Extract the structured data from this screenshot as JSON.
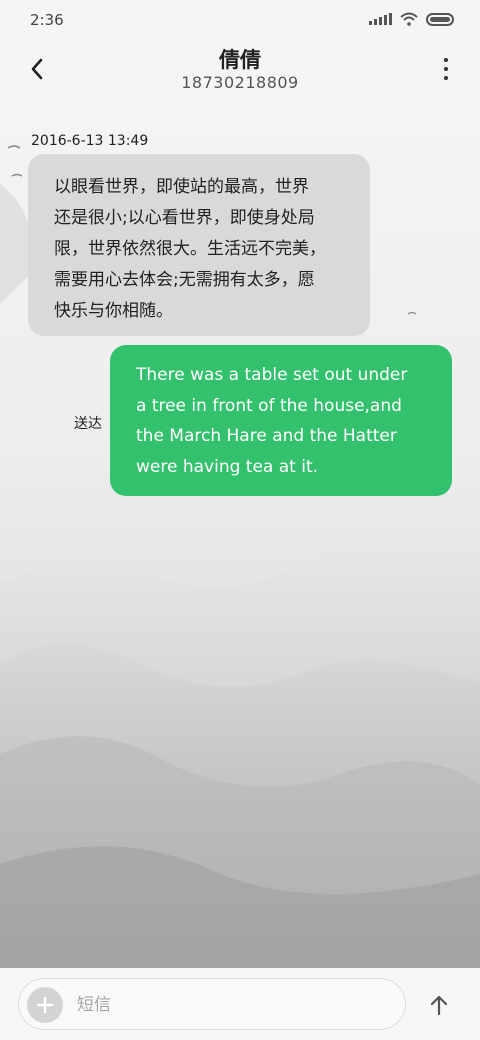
{
  "status_bar": {
    "time": "2:36",
    "icons": [
      "signal-icon",
      "wifi-icon",
      "battery-icon"
    ]
  },
  "header": {
    "back_icon": "chevron-left-icon",
    "contact_name": "倩倩",
    "phone_number": "18730218809",
    "more_icon": "more-vertical-icon"
  },
  "conversation": {
    "timestamp": "2016-6-13 13:49",
    "messages": [
      {
        "direction": "incoming",
        "lines": [
          "以眼看世界，即使站的最高，世界",
          "还是很小;以心看世界，即使身处局",
          "限，世界依然很大。生活远不完美，",
          "需要用心去体会;无需拥有太多，愿",
          "快乐与你相随。"
        ]
      },
      {
        "direction": "outgoing",
        "status": "送达",
        "lines": [
          "There was a table set out under",
          "a tree in front of the house,and",
          "the March Hare and the Hatter",
          "were having tea at it."
        ]
      }
    ]
  },
  "composer": {
    "add_icon": "plus-icon",
    "placeholder": "短信",
    "send_icon": "arrow-up-icon"
  },
  "colors": {
    "incoming_bubble": "#d9d9d9",
    "outgoing_bubble": "#34c16e",
    "outgoing_text": "#ffffff"
  }
}
